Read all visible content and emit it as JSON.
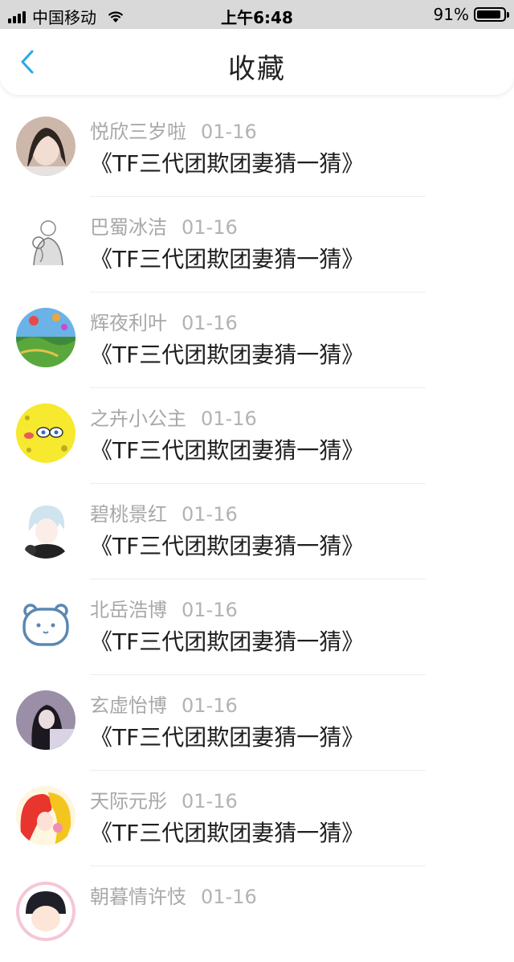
{
  "status_bar": {
    "carrier": "中国移动",
    "time": "上午6:48",
    "battery_percent": "91%",
    "battery_level": 0.91
  },
  "nav": {
    "title": "收藏",
    "back_icon": "chevron-left-icon",
    "accent_color": "#2aa7e8"
  },
  "favorites": [
    {
      "user": "悦欣三岁啦",
      "date": "01-16",
      "title": "《TF三代团欺团妻猜一猜》"
    },
    {
      "user": "巴蜀冰洁",
      "date": "01-16",
      "title": "《TF三代团欺团妻猜一猜》"
    },
    {
      "user": "辉夜利叶",
      "date": "01-16",
      "title": "《TF三代团欺团妻猜一猜》"
    },
    {
      "user": "之卉小公主",
      "date": "01-16",
      "title": "《TF三代团欺团妻猜一猜》"
    },
    {
      "user": "碧桃景红",
      "date": "01-16",
      "title": "《TF三代团欺团妻猜一猜》"
    },
    {
      "user": "北岳浩博",
      "date": "01-16",
      "title": "《TF三代团欺团妻猜一猜》"
    },
    {
      "user": "玄虚怡博",
      "date": "01-16",
      "title": "《TF三代团欺团妻猜一猜》"
    },
    {
      "user": "天际元彤",
      "date": "01-16",
      "title": "《TF三代团欺团妻猜一猜》"
    },
    {
      "user": "朝暮情许忮",
      "date": "01-16",
      "title": ""
    }
  ]
}
